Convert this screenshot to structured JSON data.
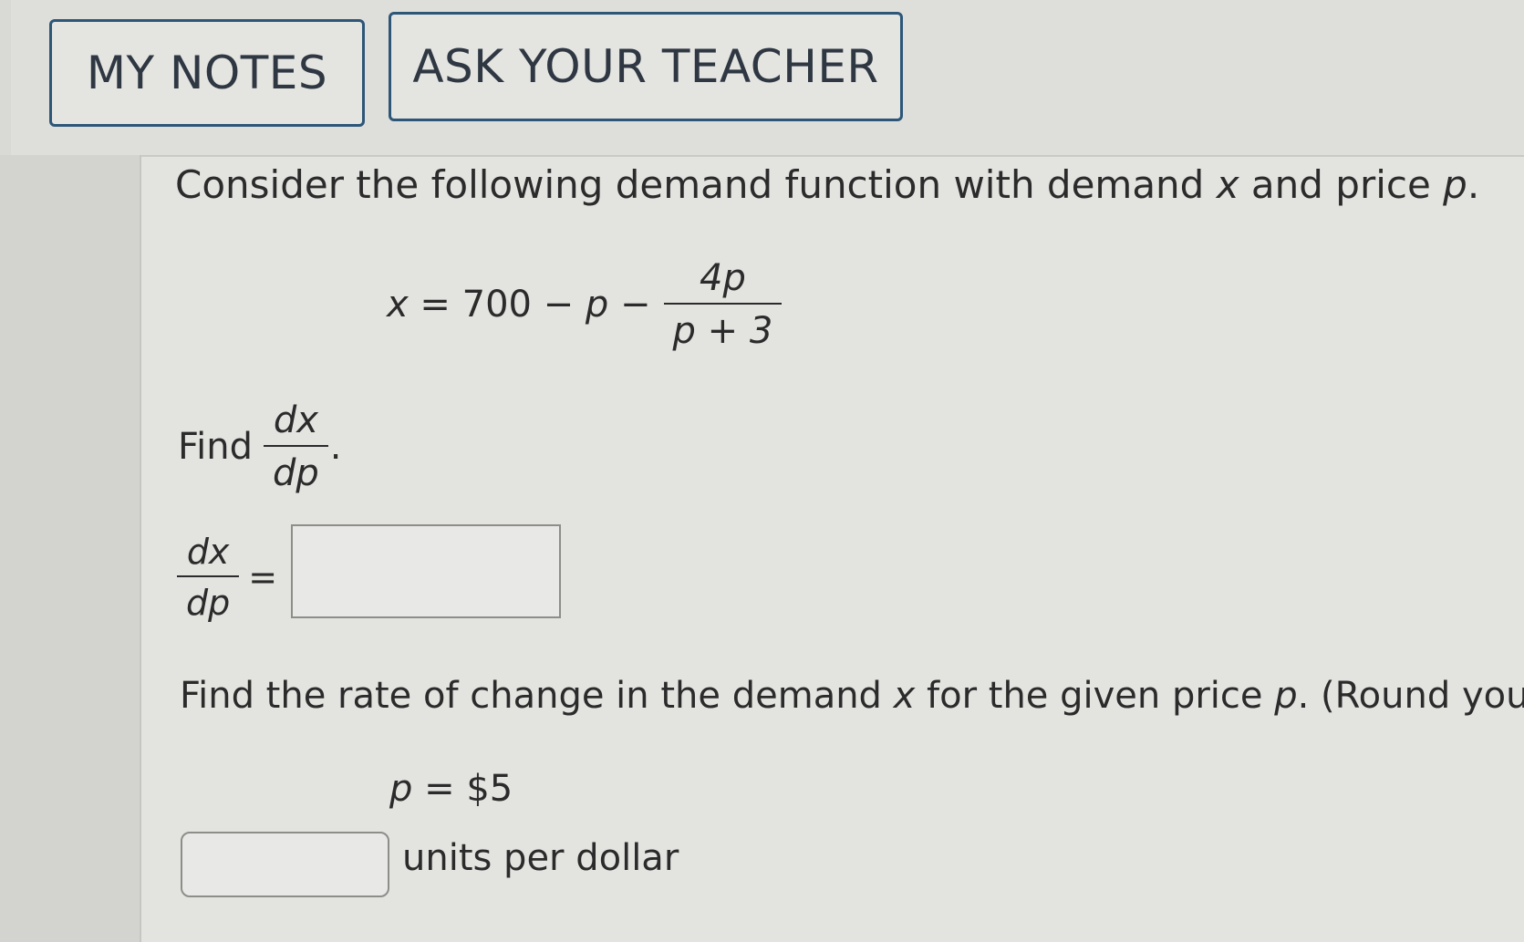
{
  "header": {
    "my_notes_label": "MY NOTES",
    "ask_teacher_label": "ASK YOUR TEACHER"
  },
  "problem": {
    "intro_prefix": "Consider the following demand function with demand ",
    "intro_var_x": "x",
    "intro_mid": " and price ",
    "intro_var_p": "p",
    "intro_end": ".",
    "equation": {
      "lhs": "x",
      "middle": " = 700 − ",
      "p_var": "p",
      "minus": " −",
      "fraction_num": "4p",
      "fraction_den": "p + 3"
    },
    "find_label": "Find",
    "find_num": "dx",
    "find_den": "dp",
    "find_end": ".",
    "deriv_num": "dx",
    "deriv_den": "dp",
    "deriv_eq": "=",
    "answer1_value": "",
    "rate_prefix": "Find the rate of change in the demand ",
    "rate_var_x": "x",
    "rate_mid": " for the given price ",
    "rate_var_p": "p",
    "rate_end": ". (Round you",
    "price_var": "p",
    "price_value": " = $5",
    "answer2_value": "",
    "units_label": "units per dollar"
  }
}
